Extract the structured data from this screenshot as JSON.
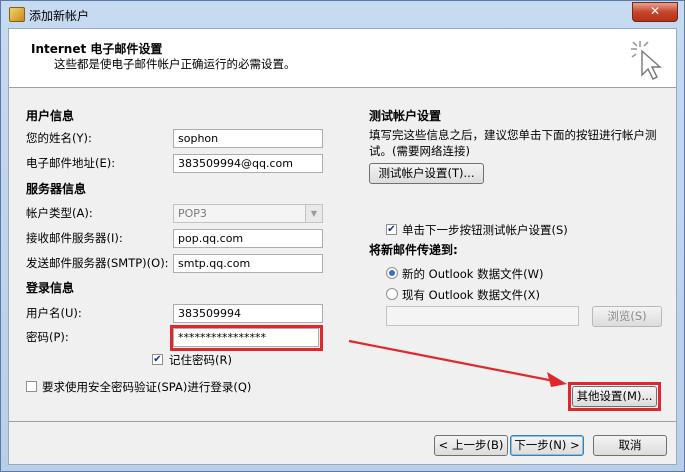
{
  "window": {
    "title": "添加新帐户",
    "close": "✕"
  },
  "header": {
    "title": "Internet 电子邮件设置",
    "subtitle": "这些都是使电子邮件帐户正确运行的必需设置。"
  },
  "user_info": {
    "section": "用户信息",
    "name_label": "您的姓名(Y):",
    "name_value": "sophon",
    "email_label": "电子邮件地址(E):",
    "email_value": "383509994@qq.com"
  },
  "server_info": {
    "section": "服务器信息",
    "account_type_label": "帐户类型(A):",
    "account_type_value": "POP3",
    "incoming_label": "接收邮件服务器(I):",
    "incoming_value": "pop.qq.com",
    "outgoing_label": "发送邮件服务器(SMTP)(O):",
    "outgoing_value": "smtp.qq.com"
  },
  "login_info": {
    "section": "登录信息",
    "username_label": "用户名(U):",
    "username_value": "383509994",
    "password_label": "密码(P):",
    "password_value": "****************",
    "remember_label": "记住密码(R)",
    "spa_label": "要求使用安全密码验证(SPA)进行登录(Q)"
  },
  "test": {
    "section": "测试帐户设置",
    "description": "填写完这些信息之后，建议您单击下面的按钮进行帐户测试。(需要网络连接)",
    "button": "测试帐户设置(T)...",
    "auto_test_label": "单击下一步按钮测试帐户设置(S)"
  },
  "deliver": {
    "section": "将新邮件传递到:",
    "new_file_label": "新的 Outlook 数据文件(W)",
    "existing_file_label": "现有 Outlook 数据文件(X)",
    "browse_button": "浏览(S)"
  },
  "more_settings_button": "其他设置(M)...",
  "footer": {
    "back": "< 上一步(B)",
    "next": "下一步(N) >",
    "cancel": "取消"
  }
}
